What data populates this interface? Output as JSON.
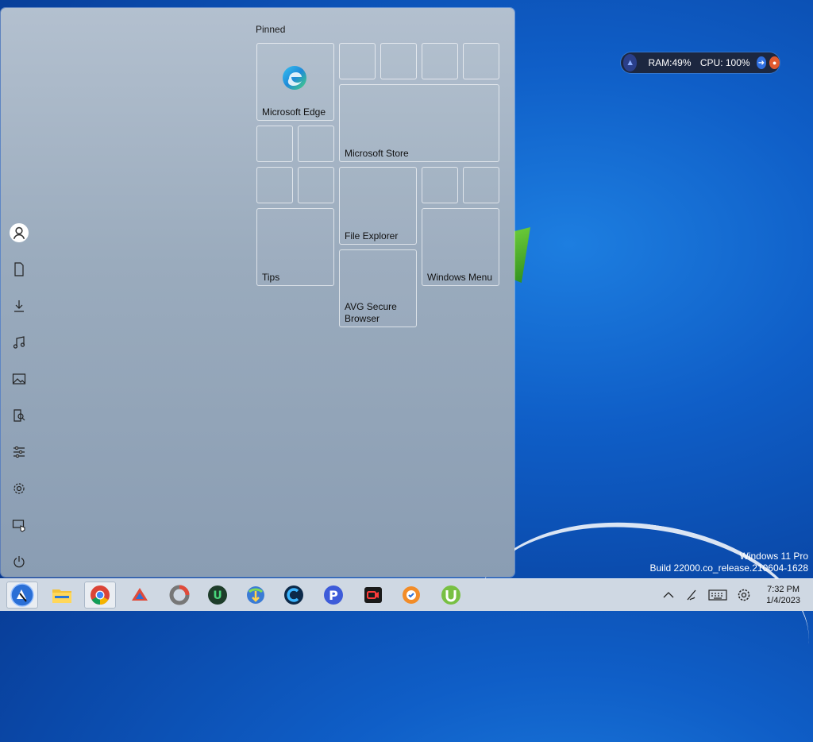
{
  "widget": {
    "ram": "RAM:49%",
    "cpu": "CPU: 100%"
  },
  "watermark": {
    "line1": "Windows 11 Pro",
    "line2": "Build 22000.co_release.210604-1628"
  },
  "start_menu": {
    "pinned_label": "Pinned",
    "tiles": [
      {
        "label": "Microsoft Edge",
        "icon": "edge-icon"
      },
      {
        "label": "Microsoft Store",
        "icon": ""
      },
      {
        "label": "File Explorer",
        "icon": ""
      },
      {
        "label": "Tips",
        "icon": ""
      },
      {
        "label": "Windows Menu",
        "icon": ""
      },
      {
        "label": "AVG Secure Browser",
        "icon": ""
      }
    ],
    "rail": [
      "user-icon",
      "documents-icon",
      "downloads-icon",
      "music-icon",
      "pictures-icon",
      "videos-icon",
      "personalization-icon",
      "settings-icon",
      "network-icon",
      "power-icon"
    ]
  },
  "taskbar": {
    "apps": [
      "start-orb-icon",
      "file-explorer-icon",
      "chrome-icon",
      "ccleaner-icon",
      "app-circle-icon",
      "uget-icon",
      "idm-icon",
      "ccleaner-c-icon",
      "p-app-icon",
      "screen-recorder-icon",
      "secure-browser-icon",
      "utorrent-icon"
    ],
    "tray": [
      "chevron-up-icon",
      "pen-icon",
      "keyboard-icon",
      "gear-icon"
    ],
    "time": "7:32 PM",
    "date": "1/4/2023"
  }
}
